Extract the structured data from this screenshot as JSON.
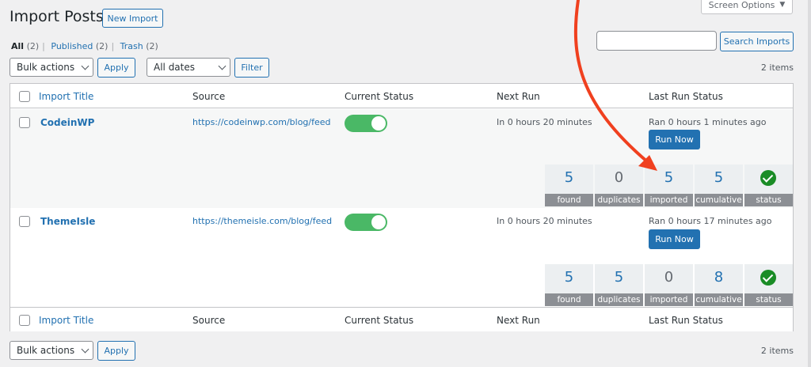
{
  "page": {
    "title": "Import Posts",
    "new_import": "New Import",
    "screen_options": "Screen Options"
  },
  "filters": {
    "all": "All",
    "all_count": "(2)",
    "published": "Published",
    "published_count": "(2)",
    "trash": "Trash",
    "trash_count": "(2)"
  },
  "search": {
    "placeholder": "",
    "button": "Search Imports"
  },
  "actions": {
    "bulk": "Bulk actions",
    "apply": "Apply",
    "dates": "All dates",
    "filter": "Filter",
    "items_count": "2 items"
  },
  "columns": [
    "Import Title",
    "Source",
    "Current Status",
    "Next Run",
    "Last Run Status"
  ],
  "rows": [
    {
      "title": "CodeinWP",
      "source": "https://codeinwp.com/blog/feed",
      "next_run": "In 0 hours 20 minutes",
      "last_run": "Ran 0 hours 1 minutes ago",
      "run_now": "Run Now",
      "stats": [
        {
          "value": "5",
          "label": "found"
        },
        {
          "value": "0",
          "label": "duplicates"
        },
        {
          "value": "5",
          "label": "imported"
        },
        {
          "value": "5",
          "label": "cumulative"
        },
        {
          "label": "status"
        }
      ]
    },
    {
      "title": "ThemeIsle",
      "source": "https://themeisle.com/blog/feed",
      "next_run": "In 0 hours 20 minutes",
      "last_run": "Ran 0 hours 17 minutes ago",
      "run_now": "Run Now",
      "stats": [
        {
          "value": "5",
          "label": "found"
        },
        {
          "value": "5",
          "label": "duplicates"
        },
        {
          "value": "0",
          "label": "imported"
        },
        {
          "value": "8",
          "label": "cumulative"
        },
        {
          "label": "status"
        }
      ]
    }
  ],
  "colors": {
    "accent": "#2271b1",
    "toggle_on": "#4ab866",
    "status_ok": "#1a8c26",
    "annotation_arrow": "#f0401f"
  }
}
